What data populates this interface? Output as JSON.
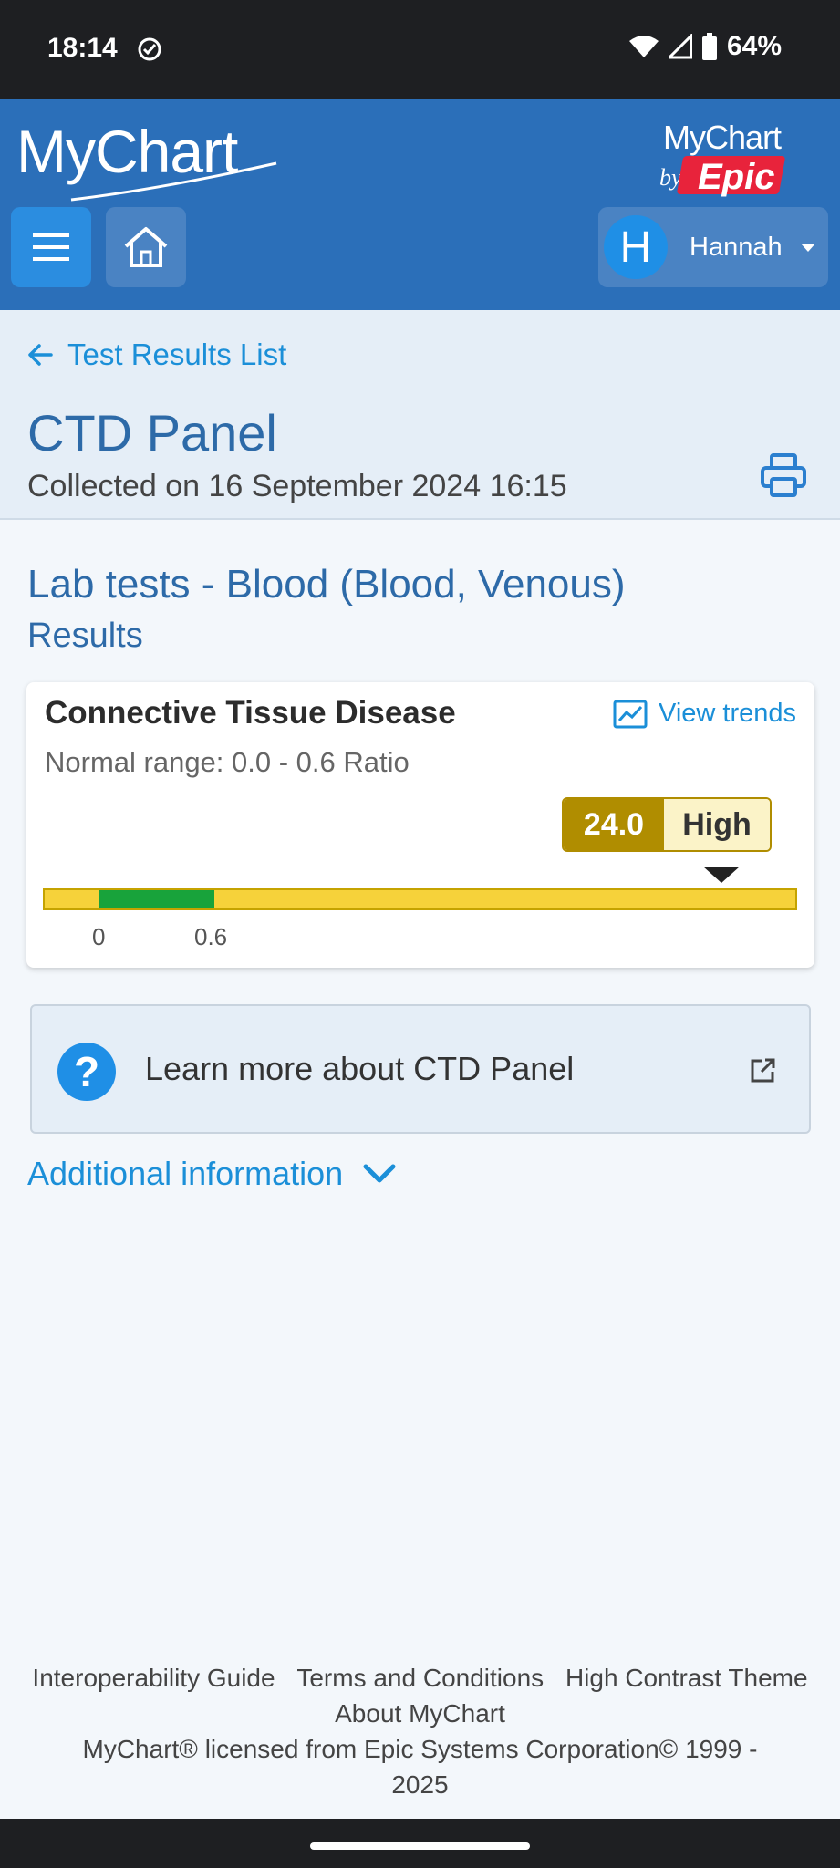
{
  "status_bar": {
    "time": "18:14",
    "battery": "64%"
  },
  "header": {
    "logo": "MyChart",
    "logo_epic_top": "MyChart",
    "logo_epic_by": "by",
    "logo_epic_word": "Epic",
    "user_initial": "H",
    "user_name": "Hannah"
  },
  "nav": {
    "back_label": "Test Results List"
  },
  "page": {
    "title": "CTD Panel",
    "collected": "Collected on 16 September 2024 16:15"
  },
  "section": {
    "title": "Lab tests - Blood (Blood, Venous)",
    "subtitle": "Results"
  },
  "result": {
    "name": "Connective Tissue Disease",
    "view_trends": "View trends",
    "normal_range": "Normal range: 0.0 - 0.6 Ratio",
    "value": "24.0",
    "flag": "High",
    "tick_low": "0",
    "tick_high": "0.6",
    "colors": {
      "out_of_range": "#f6d23a",
      "normal": "#18a33b",
      "flag": "#b08d00"
    }
  },
  "learn_more": {
    "label": "Learn more about CTD Panel"
  },
  "additional_info": {
    "label": "Additional information"
  },
  "footer": {
    "links": [
      "Interoperability Guide",
      "Terms and Conditions",
      "High Contrast Theme",
      "About MyChart"
    ],
    "copyright": "MyChart® licensed from Epic Systems Corporation© 1999 - 2025"
  },
  "icons": [
    "check-circle-icon",
    "wifi-icon",
    "signal-icon",
    "battery-icon",
    "hamburger-icon",
    "home-icon",
    "caret-down-icon",
    "back-arrow-icon",
    "print-icon",
    "trend-chart-icon",
    "question-icon",
    "external-link-icon",
    "chevron-down-icon"
  ]
}
